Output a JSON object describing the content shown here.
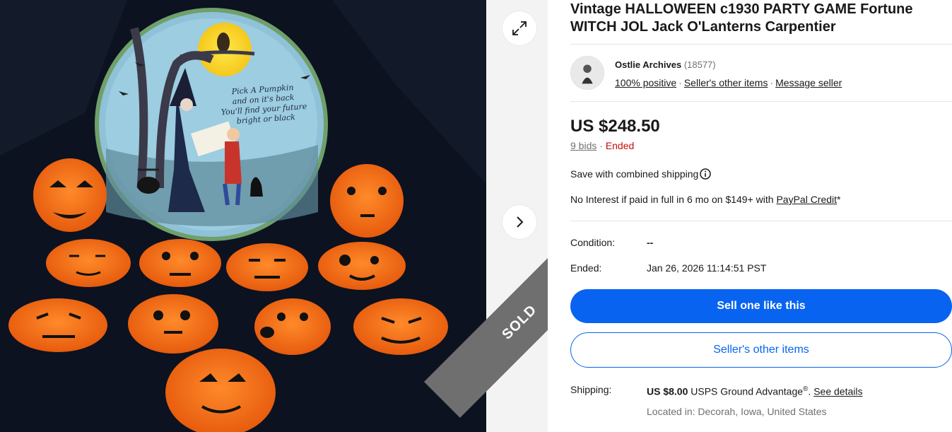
{
  "gallery": {
    "photo_caption": "Pick A Pumpkin and on it's back You'll find your future bright or black",
    "sold_label": "SOLD",
    "expand_icon": "expand-icon",
    "next_icon": "chevron-right-icon"
  },
  "listing": {
    "title_line1": "Vintage HALLOWEEN c1930 PARTY GAME Fortune",
    "title_line2": "WITCH JOL Jack O'Lanterns Carpentier"
  },
  "seller": {
    "name": "Ostlie Archives",
    "feedback_count": "(18577)",
    "positive": "100% positive",
    "other_items_link": "Seller's other items",
    "message_link": "Message seller"
  },
  "pricing": {
    "price": "US $248.50",
    "bids": "9 bids",
    "separator": "·",
    "status": "Ended",
    "combined_shipping": "Save with combined shipping",
    "interest_text": "No Interest if paid in full in 6 mo on $149+ with ",
    "paypal_credit": "PayPal Credit",
    "asterisk": "*"
  },
  "details": {
    "condition_label": "Condition:",
    "condition_value": "--",
    "ended_label": "Ended:",
    "ended_value": "Jan 26, 2026 11:14:51 PST"
  },
  "actions": {
    "sell_one": "Sell one like this",
    "sellers_other_items": "Seller's other items"
  },
  "shipping": {
    "label": "Shipping:",
    "price": "US $8.00",
    "service": " USPS Ground Advantage",
    "registered": "®",
    "period": ". ",
    "see_details": "See details",
    "located_label": "Located in: ",
    "location": "Decorah, Iowa, United States"
  },
  "colors": {
    "accent": "#0864f0",
    "ended": "#c70d0d",
    "muted": "#707070",
    "ribbon": "#6f6f6f"
  }
}
